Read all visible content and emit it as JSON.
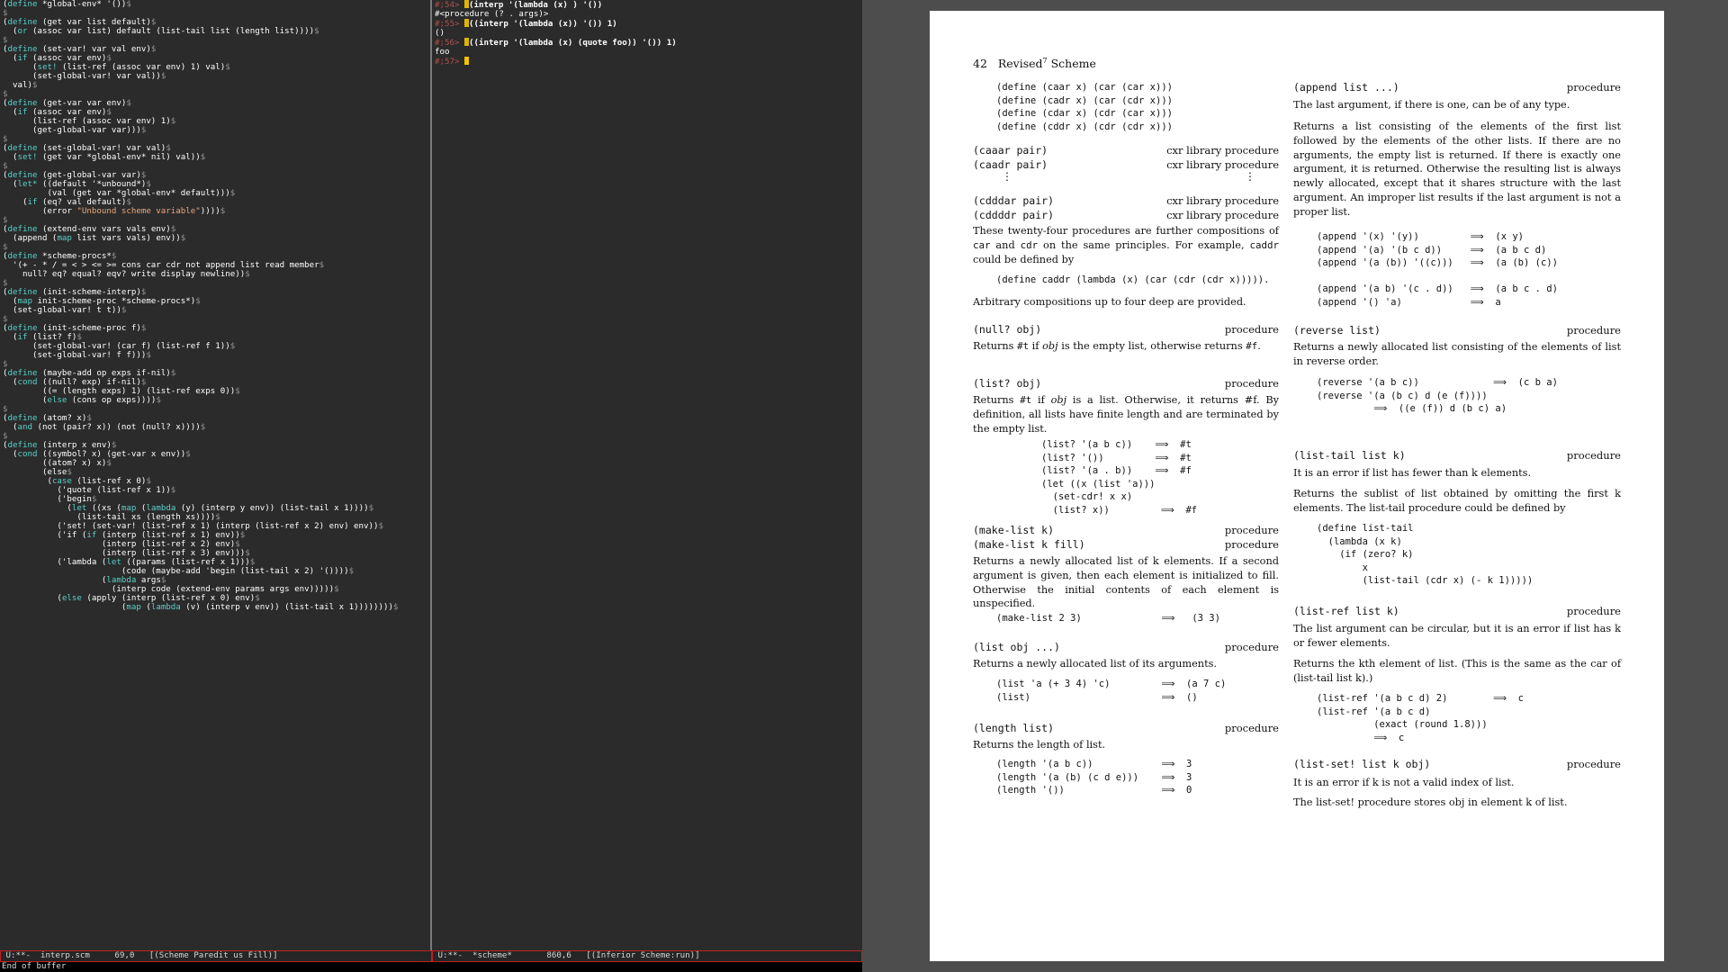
{
  "left_buffer": {
    "code": [
      "(define *global-env* '())$",
      "$",
      "(define (get var list default)$",
      "  (or (assoc var list) default (list-tail list (length list))))$",
      "$",
      "(define (set-var! var val env)$",
      "  (if (assoc var env)$",
      "      (set! (list-ref (assoc var env) 1) val)$",
      "      (set-global-var! var val))$",
      "  val)$",
      "$",
      "(define (get-var var env)$",
      "  (if (assoc var env)$",
      "      (list-ref (assoc var env) 1)$",
      "      (get-global-var var)))$",
      "$",
      "(define (set-global-var! var val)$",
      "  (set! (get var *global-env* nil) val))$",
      "$",
      "(define (get-global-var var)$",
      "  (let* ((default '*unbound*)$",
      "         (val (get var *global-env* default)))$",
      "    (if (eq? val default)$",
      "        (error \"Unbound scheme variable\"))))$",
      "$",
      "(define (extend-env vars vals env)$",
      "  (append (map list vars vals) env))$",
      "$",
      "(define *scheme-procs*$",
      "  '(+ - * / = < > <= >= cons car cdr not append list read member$",
      "    null? eq? equal? eqv? write display newline))$",
      "$",
      "(define (init-scheme-interp)$",
      "  (map init-scheme-proc *scheme-procs*)$",
      "  (set-global-var! t t))$",
      "$",
      "(define (init-scheme-proc f)$",
      "  (if (list? f)$",
      "      (set-global-var! (car f) (list-ref f 1))$",
      "      (set-global-var! f f)))$",
      "$",
      "(define (maybe-add op exps if-nil)$",
      "  (cond ((null? exp) if-nil)$",
      "        ((= (length exps) 1) (list-ref exps 0))$",
      "        (else (cons op exps))))$",
      "$",
      "(define (atom? x)$",
      "  (and (not (pair? x)) (not (null? x))))$",
      "$",
      "(define (interp x env)$",
      "  (cond ((symbol? x) (get-var x env))$",
      "        ((atom? x) x)$",
      "        (else$",
      "         (case (list-ref x 0)$",
      "           ('quote (list-ref x 1))$",
      "           ('begin$",
      "             (let ((xs (map (lambda (y) (interp y env)) (list-tail x 1))))$",
      "               (list-tail xs (length xs))))$",
      "           ('set! (set-var! (list-ref x 1) (interp (list-ref x 2) env) env))$",
      "           ('if (if (interp (list-ref x 1) env))$",
      "                    (interp (list-ref x 2) env)$",
      "                    (interp (list-ref x 3) env)))$",
      "           ('lambda (let ((params (list-ref x 1)))$",
      "                        (code (maybe-add 'begin (list-tail x 2) '())))$",
      "                    (lambda args$",
      "                      (interp code (extend-env params args env)))))$",
      "           (else (apply (interp (list-ref x 0) env)$",
      "                        (map (lambda (v) (interp v env)) (list-tail x 1))))))))$"
    ],
    "modeline": " U:**-  interp.scm     69,0   [(Scheme Paredit us Fill)]"
  },
  "middle_buffer": {
    "lines": [
      {
        "prompt": "#;54> ",
        "input": "(interp '(lambda (x) ) '())"
      },
      {
        "output": "#<procedure (? . args)>"
      },
      {
        "prompt": "#;55> ",
        "input": "((interp '(lambda (x)) '()) 1)"
      },
      {
        "output": "()"
      },
      {
        "prompt": "#;56> ",
        "input": "((interp '(lambda (x) (quote foo)) '()) 1)"
      },
      {
        "output": "foo"
      },
      {
        "prompt": "#;57> ",
        "input": ""
      }
    ],
    "modeline": " U:**-  *scheme*       860,6   [(Inferior Scheme:run)]"
  },
  "echo_area": "End of buffer",
  "pdf_page": {
    "page_number": "42",
    "running_title": "Revised",
    "running_title_sup": "7",
    "running_title_tail": " Scheme",
    "left_column": {
      "cxr_defs": "(define (caar x) (car (car x)))\n(define (cadr x) (car (cdr x)))\n(define (cdar x) (cdr (car x)))\n(define (cddr x) (cdr (cdr x)))",
      "caaar_hdr": "(caaar pair)",
      "caadr_hdr": "(caadr pair)",
      "cdddar_hdr": "(cdddar pair)",
      "cddddr_hdr": "(cddddr pair)",
      "cxr_kind": "cxr library procedure",
      "cxr_text1": "These twenty-four procedures are further compositions of",
      "cxr_text2": "on the same principles. For example,",
      "cxr_text3": "could be defined by",
      "caddr_def": "(define caddr (lambda (x) (car (cdr (cdr x))))).",
      "arbitrary": "Arbitrary compositions up to four deep are provided.",
      "null_hdr": "(null? obj)",
      "null_text": "is the empty list, otherwise returns",
      "list_hdr": "(list? obj)",
      "list_text": "is a list. Otherwise, it returns #f. By definition, all lists have finite length and are terminated by the empty list.",
      "list_examples": "(list? '(a b c))    ⟹  #t\n(list? '())         ⟹  #t\n(list? '(a . b))    ⟹  #f\n(let ((x (list 'a)))\n  (set-cdr! x x)\n  (list? x))         ⟹  #f",
      "makelist_hdr1": "(make-list k)",
      "makelist_hdr2": "(make-list k fill)",
      "makelist_text": "Returns a newly allocated list of k elements. If a second argument is given, then each element is initialized to fill. Otherwise the initial contents of each element is unspecified.",
      "makelist_example": "(make-list 2 3)              ⟹   (3 3)",
      "listp_hdr": "(list obj ...)",
      "listp_text": "Returns a newly allocated list of its arguments.",
      "listp_examples": "(list 'a (+ 3 4) 'c)         ⟹  (a 7 c)\n(list)                       ⟹  ()",
      "length_hdr": "(length list)",
      "length_text": "Returns the length of list.",
      "length_examples": "(length '(a b c))            ⟹  3\n(length '(a (b) (c d e)))    ⟹  3\n(length '())                 ⟹  0"
    },
    "right_column": {
      "append_hdr": "(append list ...)",
      "append_text1": "The last argument, if there is one, can be of any type.",
      "append_text2": "Returns a list consisting of the elements of the first list followed by the elements of the other lists. If there are no arguments, the empty list is returned. If there is exactly one argument, it is returned. Otherwise the resulting list is always newly allocated, except that it shares structure with the last argument. An improper list results if the last argument is not a proper list.",
      "append_examples": "(append '(x) '(y))         ⟹  (x y)\n(append '(a) '(b c d))     ⟹  (a b c d)\n(append '(a (b)) '((c)))   ⟹  (a (b) (c))\n\n(append '(a b) '(c . d))   ⟹  (a b c . d)\n(append '() 'a)            ⟹  a",
      "reverse_hdr": "(reverse list)",
      "reverse_text": "Returns a newly allocated list consisting of the elements of list in reverse order.",
      "reverse_examples": "(reverse '(a b c))             ⟹  (c b a)\n(reverse '(a (b c) d (e (f))))\n          ⟹  ((e (f)) d (b c) a)",
      "listtail_hdr": "(list-tail list k)",
      "listtail_text1": "It is an error if list has fewer than k elements.",
      "listtail_text2": "Returns the sublist of list obtained by omitting the first k elements. The list-tail procedure could be defined by",
      "listtail_def": "(define list-tail\n  (lambda (x k)\n    (if (zero? k)\n        x\n        (list-tail (cdr x) (- k 1)))))",
      "listref_hdr": "(list-ref list k)",
      "listref_text1": "The list argument can be circular, but it is an error if list has k or fewer elements.",
      "listref_text2": "Returns the kth element of list. (This is the same as the car of (list-tail list k).)",
      "listref_examples": "(list-ref '(a b c d) 2)        ⟹  c\n(list-ref '(a b c d)\n          (exact (round 1.8)))\n          ⟹  c",
      "listset_hdr": "(list-set! list k obj)",
      "listset_text1": "It is an error if k is not a valid index of list.",
      "listset_text2": "The list-set! procedure stores obj in element k of list."
    },
    "procedure_label": "procedure",
    "vdots": "⋮"
  }
}
